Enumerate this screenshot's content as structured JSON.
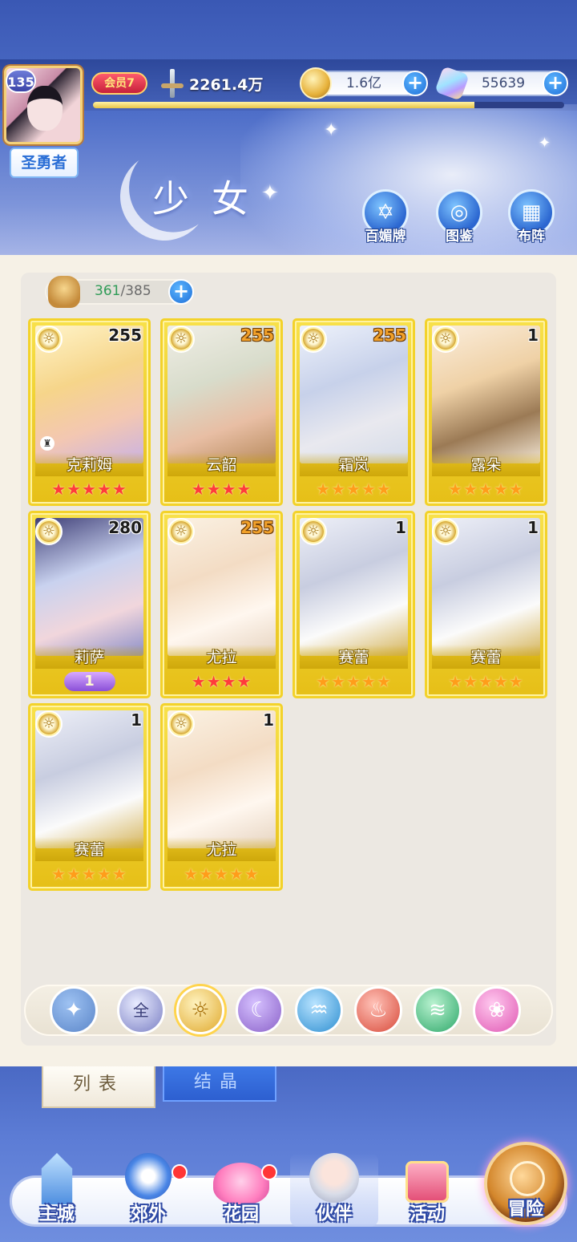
{
  "player": {
    "level": "135",
    "title": "圣勇者",
    "vip": "会员7",
    "power": "2261.4万",
    "exp_fraction": 0.81
  },
  "currencies": {
    "coin": "1.6亿",
    "gem": "55639",
    "plus": "+"
  },
  "page_title": "少女",
  "top_buttons": [
    {
      "label": "百媚牌",
      "icon": "card-deck-icon"
    },
    {
      "label": "图鉴",
      "icon": "book-icon"
    },
    {
      "label": "布阵",
      "icon": "grid-formation-icon"
    }
  ],
  "capacity": {
    "used": "361",
    "separator": "/",
    "total": "385",
    "plus": "+"
  },
  "cards": [
    {
      "name": "克莉姆",
      "level": "255",
      "stars": "★★★★★",
      "star_color": "red",
      "element": "sun-element-icon"
    },
    {
      "name": "云韶",
      "level": "255",
      "stars": "★★★★",
      "star_color": "red",
      "element": "sun-element-icon"
    },
    {
      "name": "霜岚",
      "level": "255",
      "stars": "★★★★★",
      "star_color": "gold",
      "element": "sun-element-icon"
    },
    {
      "name": "露朵",
      "level": "1",
      "stars": "★★★★★",
      "star_color": "gold",
      "element": "sun-element-icon"
    },
    {
      "name": "莉萨",
      "level": "280",
      "rank": "1",
      "element": "sun-element-icon"
    },
    {
      "name": "尤拉",
      "level": "255",
      "stars": "★★★★",
      "star_color": "red",
      "element": "sun-element-icon"
    },
    {
      "name": "赛蕾",
      "level": "1",
      "stars": "★★★★★",
      "star_color": "gold",
      "element": "sun-element-icon"
    },
    {
      "name": "赛蕾",
      "level": "1",
      "stars": "★★★★★",
      "star_color": "gold",
      "element": "sun-element-icon"
    },
    {
      "name": "赛蕾",
      "level": "1",
      "stars": "★★★★★",
      "star_color": "gold",
      "element": "sun-element-icon"
    },
    {
      "name": "尤拉",
      "level": "1",
      "stars": "★★★★★",
      "star_color": "gold",
      "element": "sun-element-icon"
    }
  ],
  "filters": [
    {
      "label": "",
      "icon": "wing-filter-icon",
      "color": "#5b86c9",
      "glyph": "✦"
    },
    {
      "label": "全",
      "icon": "all-filter-icon",
      "color": "#7a7fc4",
      "glyph": "全"
    },
    {
      "label": "",
      "icon": "sun-filter-icon",
      "color": "#e0a92d",
      "glyph": "☼"
    },
    {
      "label": "",
      "icon": "moon-filter-icon",
      "color": "#8b62c9",
      "glyph": "☾"
    },
    {
      "label": "",
      "icon": "water-filter-icon",
      "color": "#2e8fd1",
      "glyph": "💧"
    },
    {
      "label": "",
      "icon": "fire-filter-icon",
      "color": "#d84a3a",
      "glyph": "♨"
    },
    {
      "label": "",
      "icon": "wind-filter-icon",
      "color": "#2ea86a",
      "glyph": "≋"
    },
    {
      "label": "",
      "icon": "heart-filter-icon",
      "color": "#e058b3",
      "glyph": "❀"
    }
  ],
  "tabs": {
    "list": "列表",
    "crystal": "结晶"
  },
  "nav": [
    {
      "label": "主城",
      "icon": "castle-icon",
      "badge": false
    },
    {
      "label": "郊外",
      "icon": "portal-icon",
      "badge": true
    },
    {
      "label": "花园",
      "icon": "heart-garden-icon",
      "badge": true
    },
    {
      "label": "伙伴",
      "icon": "companion-icon",
      "badge": false,
      "selected": true
    },
    {
      "label": "活动",
      "icon": "gift-icon",
      "badge": false
    },
    {
      "label": "冒险",
      "icon": "compass-icon",
      "badge": false
    }
  ]
}
